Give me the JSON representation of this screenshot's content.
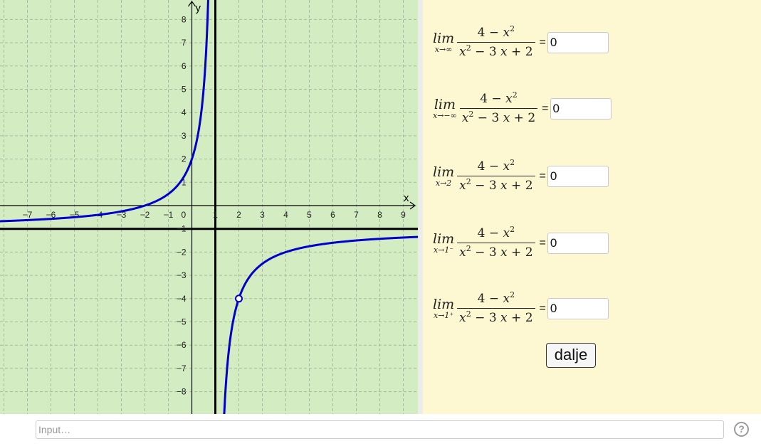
{
  "graph": {
    "x_axis_label": "x",
    "y_axis_label": "y",
    "x_range": [
      -9,
      9
    ],
    "y_range": [
      -9,
      9
    ],
    "x_ticks": [
      -7,
      -6,
      -5,
      -4,
      -3,
      -2,
      -1,
      1,
      2,
      3,
      4,
      5,
      6,
      7,
      8,
      9
    ],
    "y_ticks": [
      8,
      7,
      6,
      5,
      4,
      3,
      2,
      1,
      -1,
      -2,
      -3,
      -4,
      -5,
      -6,
      -7,
      -8
    ],
    "origin_label": "0",
    "function": "(4 - x^2)/(x^2 - 3x + 2)",
    "vertical_asymptote": 1,
    "horizontal_asymptote": -1,
    "hole": {
      "x": 2,
      "y": -4
    },
    "curve_color": "#0000cc",
    "background_color": "#d3ecc2",
    "grid": true
  },
  "limits": [
    {
      "lim": "lim",
      "sub": "x→∞",
      "numerator": {
        "a": "4 − ",
        "var": "x",
        "exp": "2"
      },
      "denominator": {
        "var": "x",
        "exp": "2",
        "rest": " − 3 ",
        "var2": "x",
        "tail": " + 2"
      },
      "equals": "=",
      "value": "0"
    },
    {
      "lim": "lim",
      "sub": "x→−∞",
      "numerator": {
        "a": "4 − ",
        "var": "x",
        "exp": "2"
      },
      "denominator": {
        "var": "x",
        "exp": "2",
        "rest": " − 3 ",
        "var2": "x",
        "tail": " + 2"
      },
      "equals": "=",
      "value": "0"
    },
    {
      "lim": "lim",
      "sub": "x→2",
      "numerator": {
        "a": "4 − ",
        "var": "x",
        "exp": "2"
      },
      "denominator": {
        "var": "x",
        "exp": "2",
        "rest": " − 3 ",
        "var2": "x",
        "tail": " + 2"
      },
      "equals": "=",
      "value": "0"
    },
    {
      "lim": "lim",
      "sub": "x→1⁻",
      "numerator": {
        "a": "4 − ",
        "var": "x",
        "exp": "2"
      },
      "denominator": {
        "var": "x",
        "exp": "2",
        "rest": " − 3 ",
        "var2": "x",
        "tail": " + 2"
      },
      "equals": "=",
      "value": "0"
    },
    {
      "lim": "lim",
      "sub": "x→1⁺",
      "numerator": {
        "a": "4 − ",
        "var": "x",
        "exp": "2"
      },
      "denominator": {
        "var": "x",
        "exp": "2",
        "rest": " − 3 ",
        "var2": "x",
        "tail": " + 2"
      },
      "equals": "=",
      "value": "0"
    }
  ],
  "next_button_label": "dalje",
  "input_bar": {
    "placeholder": "Input…"
  },
  "help_icon": "question-mark-icon",
  "help_glyph": "?",
  "colors": {
    "side_panel": "#fdf8d2",
    "graph_panel": "#d3ecc2",
    "curve": "#0000cc"
  }
}
